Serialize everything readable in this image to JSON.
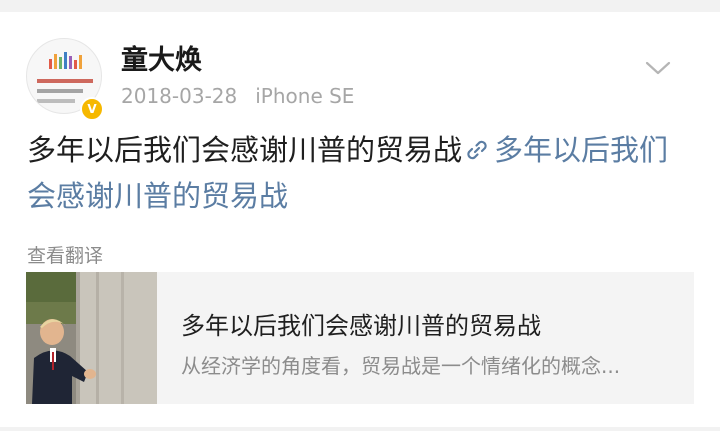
{
  "post": {
    "username": "童大焕",
    "date": "2018-03-28",
    "device": "iPhone SE",
    "text": "多年以后我们会感谢川普的贸易战",
    "link_text": "多年以后我们会感谢川普的贸易战",
    "translate_label": "查看翻译"
  },
  "link_card": {
    "title": "多年以后我们会感谢川普的贸易战",
    "description": "从经济学的角度看，贸易战是一个情绪化的概念..."
  },
  "icons": {
    "avatar": "avatar-icon",
    "verified": "verified-badge-icon",
    "menu": "chevron-down-icon",
    "link": "link-icon"
  },
  "colors": {
    "link": "#5b7da3",
    "meta": "#a6a6a6",
    "card_bg": "#f4f4f4",
    "verified": "#f6b800"
  }
}
